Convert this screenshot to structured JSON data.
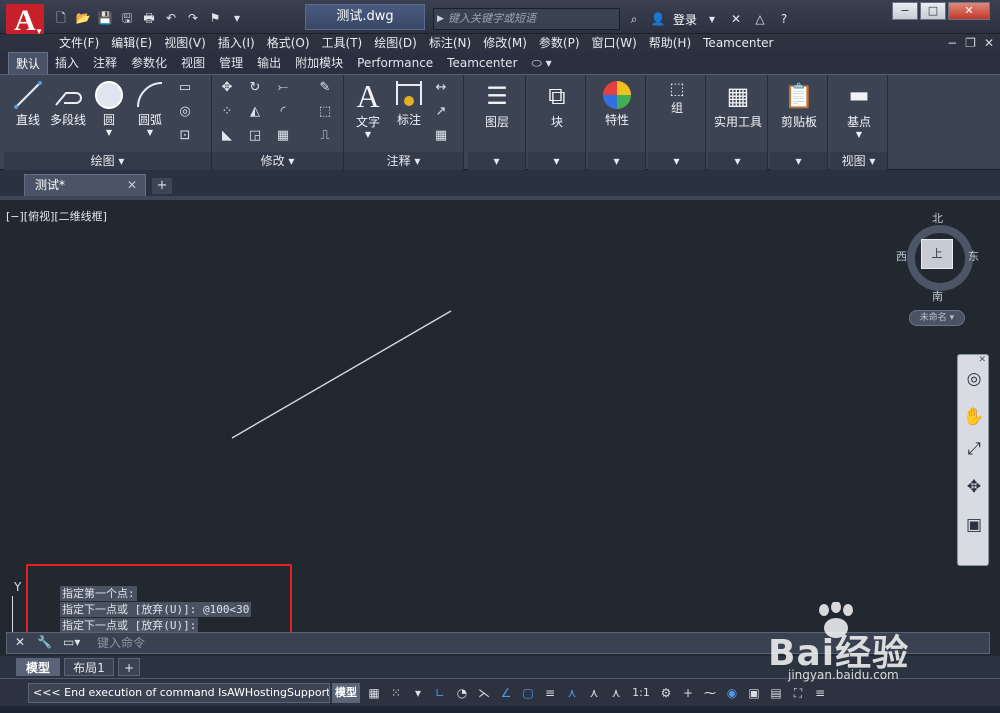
{
  "app": {
    "logo_letter": "A",
    "document_title": "测试.dwg",
    "search_placeholder": "键入关键字或短语",
    "login_label": "登录"
  },
  "menu": {
    "items": [
      "文件(F)",
      "编辑(E)",
      "视图(V)",
      "插入(I)",
      "格式(O)",
      "工具(T)",
      "绘图(D)",
      "标注(N)",
      "修改(M)",
      "参数(P)",
      "窗口(W)",
      "帮助(H)",
      "Teamcenter"
    ]
  },
  "ribbon_tabs": [
    "默认",
    "插入",
    "注释",
    "参数化",
    "视图",
    "管理",
    "输出",
    "附加模块",
    "Performance",
    "Teamcenter"
  ],
  "ribbon": {
    "draw": {
      "line": "直线",
      "polyline": "多段线",
      "circle": "圆",
      "arc": "圆弧",
      "footer": "绘图 ▾"
    },
    "modify": {
      "footer": "修改 ▾"
    },
    "annotation": {
      "text": "文字",
      "dimension": "标注",
      "footer": "注释 ▾"
    },
    "layers": "图层",
    "block": "块",
    "properties": "特性",
    "groups": "组",
    "utilities": "实用工具",
    "clipboard": "剪贴板",
    "view": {
      "base": "基点",
      "footer": "视图 ▾"
    }
  },
  "file_tab": {
    "label": "测试*"
  },
  "viewport": {
    "label": "[−][俯视][二维线框]",
    "compass": {
      "north": "北",
      "south": "南",
      "east": "东",
      "west": "西",
      "face": "上"
    },
    "ucs_name": "未命名 ▾"
  },
  "command_history": [
    "指定第一个点:",
    "指定下一点或 [放弃(U)]: @100<30",
    "指定下一点或 [放弃(U)]:"
  ],
  "command_line": {
    "placeholder": "键入命令"
  },
  "layout_tabs": [
    "模型",
    "布局1"
  ],
  "status": {
    "message": "<<< End execution of command IsAWHostingSupported",
    "model": "模型",
    "scale": "1:1"
  },
  "watermark": {
    "main": "Bai经验",
    "sub": "jingyan.baidu.com"
  },
  "colors": {
    "highlight": "#e8201f",
    "accent": "#c8202a"
  }
}
